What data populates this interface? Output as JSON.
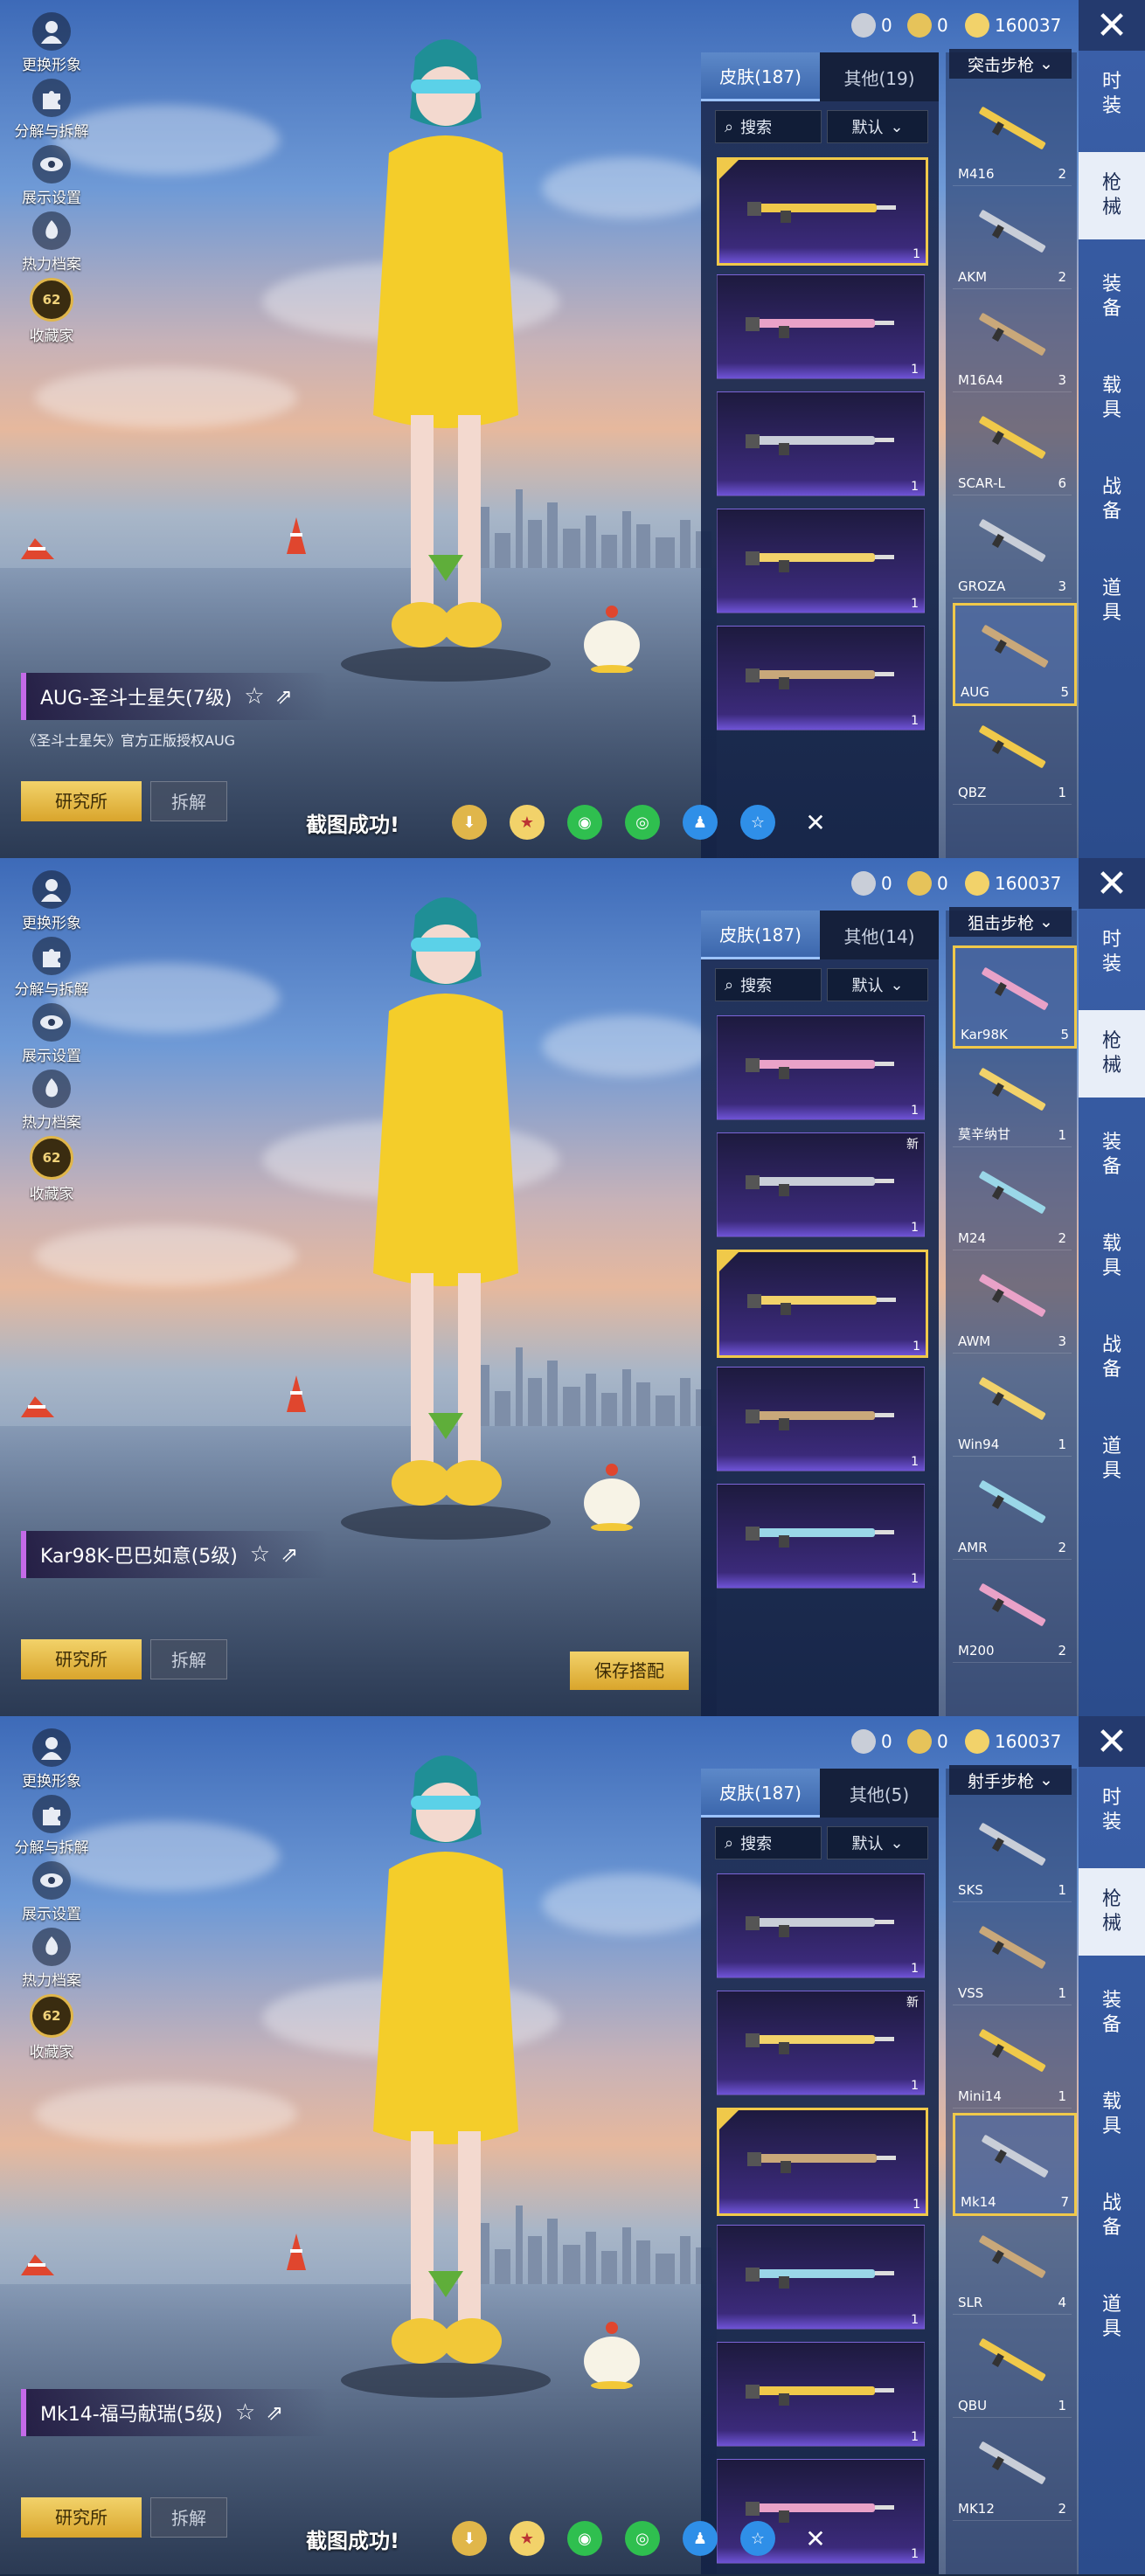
{
  "currency": {
    "items": [
      {
        "value": "0"
      },
      {
        "value": "0"
      },
      {
        "value": "160037"
      }
    ]
  },
  "left_toolbar": [
    {
      "label": "更换形象"
    },
    {
      "label": "分解与拆解"
    },
    {
      "label": "展示设置"
    },
    {
      "label": "热力档案"
    },
    {
      "label": "收藏家"
    }
  ],
  "badge_level": "62",
  "right_categories": [
    {
      "label": "时装"
    },
    {
      "label": "枪械"
    },
    {
      "label": "装备"
    },
    {
      "label": "载具"
    },
    {
      "label": "战备"
    },
    {
      "label": "道具"
    }
  ],
  "buttons": {
    "research": "研究所",
    "disassemble": "拆解",
    "save": "保存搭配"
  },
  "share": {
    "toast": "截图成功!"
  },
  "panels": [
    {
      "tab_skins": "皮肤(187)",
      "tab_other": "其他(19)",
      "search": "搜索",
      "sort": "默认",
      "category": "突击步枪",
      "weapon_title": "AUG-圣斗士星矢(7级)",
      "description": "《圣斗士星矢》官方正版授权AUG",
      "skins": [
        {
          "count": "1",
          "selected": true,
          "new": ""
        },
        {
          "count": "1",
          "selected": false,
          "new": ""
        },
        {
          "count": "1",
          "selected": false,
          "new": ""
        },
        {
          "count": "1",
          "selected": false,
          "new": ""
        },
        {
          "count": "1",
          "selected": false,
          "new": ""
        }
      ],
      "weapons": [
        {
          "name": "M416",
          "count": "2",
          "selected": false
        },
        {
          "name": "AKM",
          "count": "2",
          "selected": false
        },
        {
          "name": "M16A4",
          "count": "3",
          "selected": false
        },
        {
          "name": "SCAR-L",
          "count": "6",
          "selected": false
        },
        {
          "name": "GROZA",
          "count": "3",
          "selected": false
        },
        {
          "name": "AUG",
          "count": "5",
          "selected": true
        },
        {
          "name": "QBZ",
          "count": "1",
          "selected": false
        }
      ]
    },
    {
      "tab_skins": "皮肤(187)",
      "tab_other": "其他(14)",
      "search": "搜索",
      "sort": "默认",
      "category": "狙击步枪",
      "weapon_title": "Kar98K-巴巴如意(5级)",
      "description": "",
      "skins": [
        {
          "count": "1",
          "selected": false,
          "new": ""
        },
        {
          "count": "1",
          "selected": false,
          "new": "新"
        },
        {
          "count": "1",
          "selected": true,
          "new": ""
        },
        {
          "count": "1",
          "selected": false,
          "new": ""
        },
        {
          "count": "1",
          "selected": false,
          "new": ""
        }
      ],
      "weapons": [
        {
          "name": "Kar98K",
          "count": "5",
          "selected": true
        },
        {
          "name": "莫辛纳甘",
          "count": "1",
          "selected": false
        },
        {
          "name": "M24",
          "count": "2",
          "selected": false
        },
        {
          "name": "AWM",
          "count": "3",
          "selected": false
        },
        {
          "name": "Win94",
          "count": "1",
          "selected": false
        },
        {
          "name": "AMR",
          "count": "2",
          "selected": false
        },
        {
          "name": "M200",
          "count": "2",
          "selected": false
        }
      ]
    },
    {
      "tab_skins": "皮肤(187)",
      "tab_other": "其他(5)",
      "search": "搜索",
      "sort": "默认",
      "category": "射手步枪",
      "weapon_title": "Mk14-福马献瑞(5级)",
      "description": "",
      "skins": [
        {
          "count": "1",
          "selected": false,
          "new": ""
        },
        {
          "count": "1",
          "selected": false,
          "new": "新"
        },
        {
          "count": "1",
          "selected": true,
          "new": ""
        },
        {
          "count": "1",
          "selected": false,
          "new": ""
        },
        {
          "count": "1",
          "selected": false,
          "new": ""
        },
        {
          "count": "1",
          "selected": false,
          "new": ""
        }
      ],
      "weapons": [
        {
          "name": "SKS",
          "count": "1",
          "selected": false
        },
        {
          "name": "VSS",
          "count": "1",
          "selected": false
        },
        {
          "name": "Mini14",
          "count": "1",
          "selected": false
        },
        {
          "name": "Mk14",
          "count": "7",
          "selected": true
        },
        {
          "name": "SLR",
          "count": "4",
          "selected": false
        },
        {
          "name": "QBU",
          "count": "1",
          "selected": false
        },
        {
          "name": "MK12",
          "count": "2",
          "selected": false
        }
      ]
    }
  ],
  "colors": {
    "gold": "#f0c94a",
    "purple": "#6e53d6",
    "accent": "#c46ae8"
  }
}
